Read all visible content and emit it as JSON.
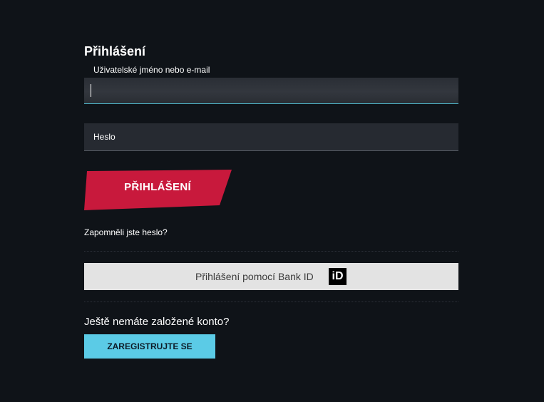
{
  "login": {
    "title": "Přihlášení",
    "username_label": "Uživatelské jméno nebo e-mail",
    "username_value": "",
    "password_placeholder": "Heslo",
    "submit_label": "PŘIHLÁŠENÍ",
    "forgot_password": "Zapomněli jste heslo?",
    "bankid_label": "Přihlášení pomocí Bank ID",
    "bankid_logo_text": "iD"
  },
  "register": {
    "prompt": "Ještě nemáte založené konto?",
    "button_label": "ZAREGISTRUJTE SE"
  },
  "colors": {
    "background": "#0f1318",
    "accent_red": "#c8193c",
    "accent_cyan": "#5bcbe6",
    "field_focus_border": "#4fb6c9",
    "bankid_bg": "#e3e3e3"
  },
  "icons": {
    "bankid": "bankid-logo-icon"
  }
}
